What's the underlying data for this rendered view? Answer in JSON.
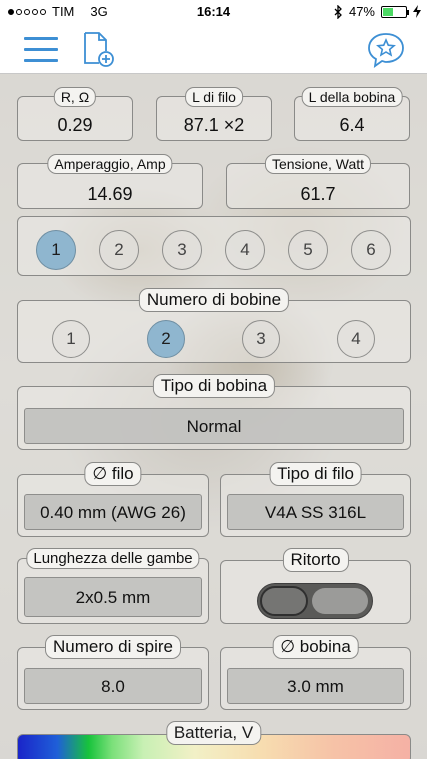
{
  "status_bar": {
    "signal_dots": [
      true,
      false,
      false,
      false,
      false
    ],
    "carrier": "TIM",
    "network": "3G",
    "time": "16:14",
    "battery_percent": "47%",
    "battery_level": 0.47
  },
  "colors": {
    "accent": "#3d8fd4",
    "selected": "#8fb6cf",
    "battery_fill": "#4cd964"
  },
  "navbar": {
    "icons": [
      "menu-icon",
      "new-file-icon",
      "chat-star-icon"
    ]
  },
  "results": {
    "resistance": {
      "label": "R, Ω",
      "value": "0.29"
    },
    "wire_length": {
      "label": "L di filo",
      "value": "87.1 ×2"
    },
    "coil_length": {
      "label": "L della bobina",
      "value": "6.4"
    },
    "current": {
      "label": "Amperaggio, Amp",
      "value": "14.69"
    },
    "power": {
      "label": "Tensione, Watt",
      "value": "61.7"
    }
  },
  "wraps": {
    "options": [
      "1",
      "2",
      "3",
      "4",
      "5",
      "6"
    ],
    "selected": "1"
  },
  "coil_count": {
    "label": "Numero di bobine",
    "options": [
      "1",
      "2",
      "3",
      "4"
    ],
    "selected": "2"
  },
  "coil_type": {
    "label": "Tipo di bobina",
    "value": "Normal"
  },
  "wire_diameter": {
    "label": "∅ filo",
    "value": "0.40 mm (AWG 26)"
  },
  "wire_type": {
    "label": "Tipo di filo",
    "value": "V4A SS 316L"
  },
  "leg_length": {
    "label": "Lunghezza delle gambe",
    "value": "2x0.5 mm"
  },
  "twisted": {
    "label": "Ritorto",
    "on": false
  },
  "turns": {
    "label": "Numero di spire",
    "value": "8.0"
  },
  "coil_diameter": {
    "label": "∅ bobina",
    "value": "3.0 mm"
  },
  "battery": {
    "label": "Batteria, V"
  }
}
